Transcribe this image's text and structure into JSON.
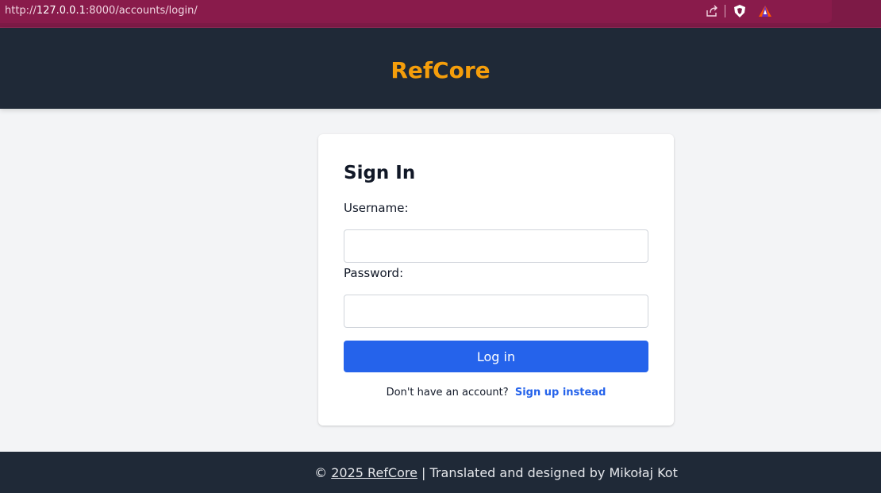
{
  "browser": {
    "url_scheme": "http://",
    "url_host": "127.0.0.1",
    "url_rest": ":8000/accounts/login/"
  },
  "header": {
    "brand": "RefCore",
    "brand_color": "#f59e0b",
    "background": "#1f2937"
  },
  "login": {
    "title": "Sign In",
    "username_label": "Username:",
    "username_value": "",
    "password_label": "Password:",
    "password_value": "",
    "submit_label": "Log in",
    "submit_color": "#2563eb",
    "signup_prompt": "Don't have an account?",
    "signup_link": "Sign up instead"
  },
  "footer": {
    "copyright_symbol": "©",
    "copyright_link": "2025 RefCore",
    "credit": "| Translated and designed by Mikołaj Kot"
  },
  "icons": [
    "share-icon",
    "brave-shield-icon",
    "brave-rewards-icon"
  ]
}
